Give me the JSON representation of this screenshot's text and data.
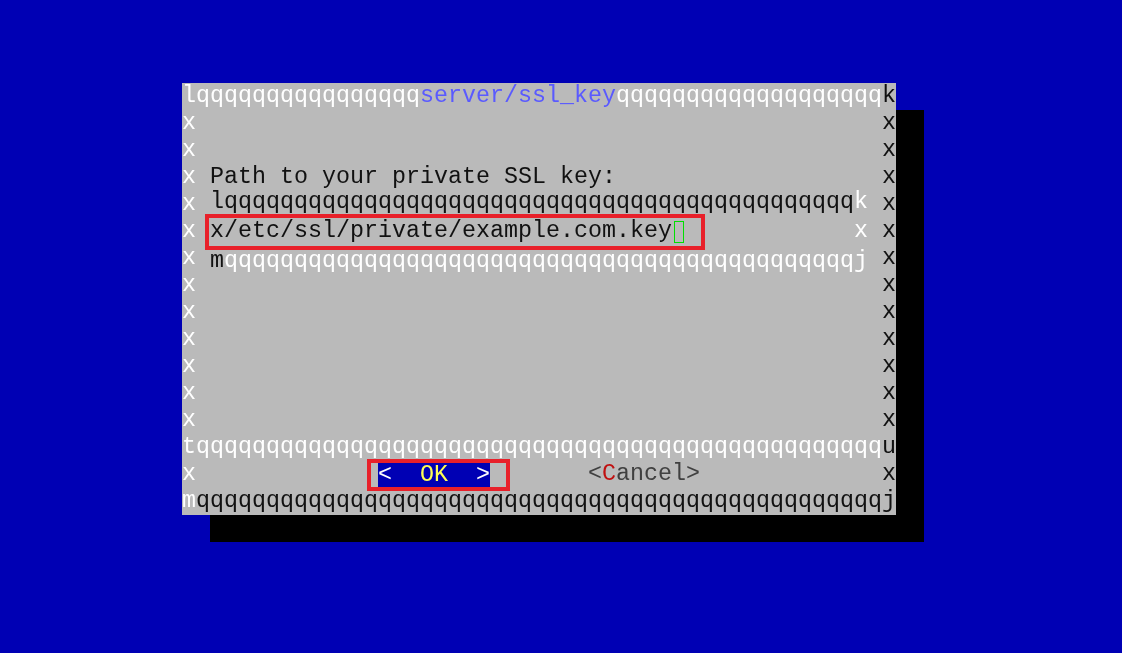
{
  "dialog": {
    "top": {
      "left": "l",
      "right": "k",
      "segments": [
        {
          "kind": "light",
          "text": "qqqqqqqqqqqqqqqq"
        },
        {
          "kind": "title",
          "text": "server/ssl_key"
        },
        {
          "kind": "light",
          "text": "qqqqqqqqqqqqqqqqqqq"
        }
      ]
    },
    "rows": [
      {
        "left": "x",
        "right": "x"
      },
      {
        "left": "x",
        "right": "x"
      },
      {
        "left": "x",
        "right": "x",
        "content": {
          "kind": "label",
          "text": "Path to your private SSL key:"
        }
      },
      {
        "left": "x",
        "right": "x",
        "content": {
          "kind": "frame",
          "segments": [
            {
              "kind": "dark",
              "text": "lqqqqqqqqqqqqqqqqqqqqqqqqqqqqqqqqqqqqqqqqqqqqq"
            },
            {
              "kind": "light",
              "text": "k"
            }
          ]
        }
      },
      {
        "left": "x",
        "right": "x",
        "content": {
          "kind": "field",
          "edge_left": "x",
          "value": "/etc/ssl/private/example.com.key",
          "cursor": true,
          "edge_right": "x",
          "highlighted": true
        }
      },
      {
        "left": "x",
        "right": "x",
        "content": {
          "kind": "frame",
          "segments": [
            {
              "kind": "dark",
              "text": "m"
            },
            {
              "kind": "light",
              "text": "qqqqqqqqqqqqqqqqqqqqqqqqqqqqqqqqqqqqqqqqqqqqqj"
            }
          ]
        }
      },
      {
        "left": "x",
        "right": "x"
      },
      {
        "left": "x",
        "right": "x"
      },
      {
        "left": "x",
        "right": "x"
      },
      {
        "left": "x",
        "right": "x"
      },
      {
        "left": "x",
        "right": "x"
      },
      {
        "left": "x",
        "right": "x"
      }
    ],
    "divider": {
      "left": "t",
      "right": "u",
      "segments": [
        {
          "kind": "light",
          "text": "qqqqqqqqqqqqqqqqqqqqqqqqqqqqqqqqqqqqqqqqqqqqqqqqq"
        }
      ]
    },
    "button_row": {
      "left": "x",
      "right": "x",
      "buttons": [
        {
          "open": "<",
          "label": "OK",
          "close": ">",
          "selected": true,
          "highlighted": true
        },
        {
          "open": "<",
          "hotkey": "C",
          "label": "ancel",
          "close": ">",
          "selected": false,
          "highlighted": false
        }
      ]
    },
    "bottom": {
      "left": "m",
      "right": "j",
      "segments": [
        {
          "kind": "dark",
          "text": "qqqqqqqqqqqqqqqqqqqqqqqqqqqqqqqqqqqqqqqqqqqqqqqqq"
        }
      ]
    }
  }
}
